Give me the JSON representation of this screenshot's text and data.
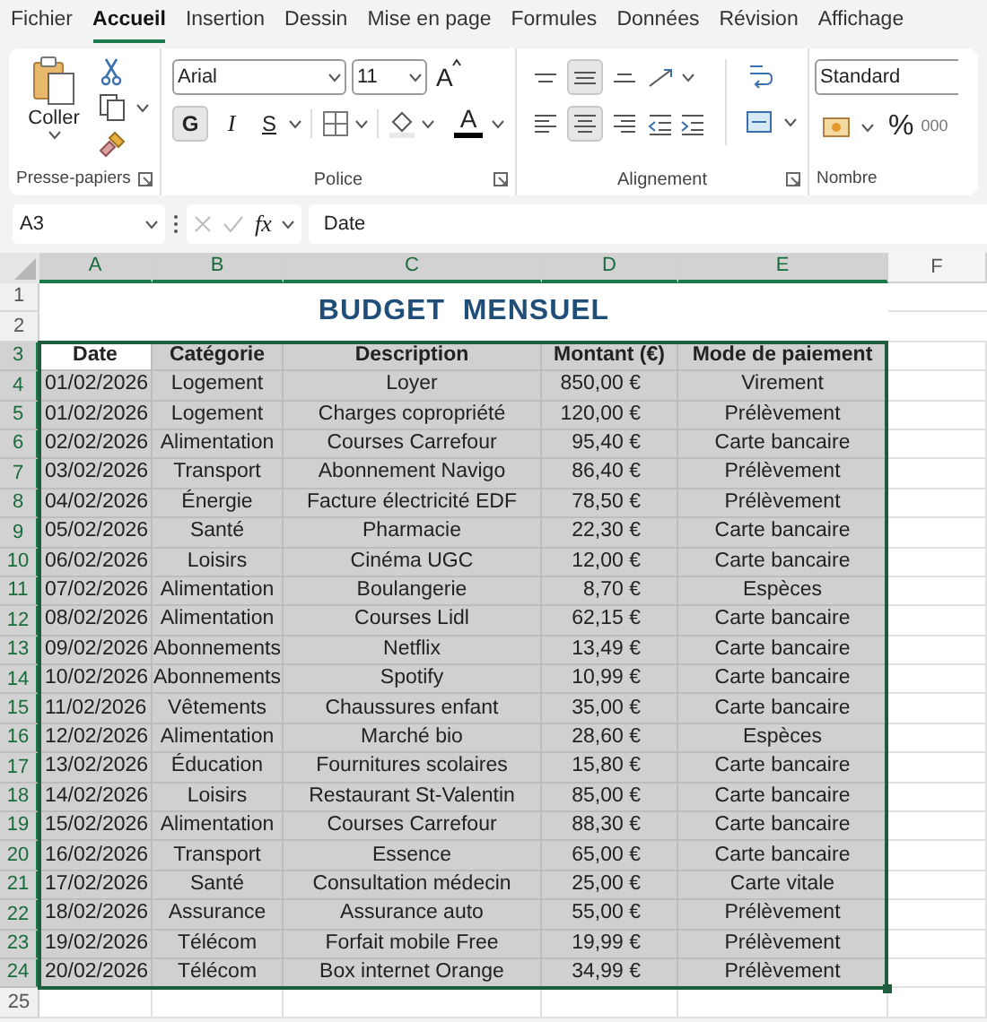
{
  "menu_tabs": [
    {
      "label": "Fichier",
      "selected": false
    },
    {
      "label": "Accueil",
      "selected": true
    },
    {
      "label": "Insertion",
      "selected": false
    },
    {
      "label": "Dessin",
      "selected": false
    },
    {
      "label": "Mise en page",
      "selected": false
    },
    {
      "label": "Formules",
      "selected": false
    },
    {
      "label": "Données",
      "selected": false
    },
    {
      "label": "Révision",
      "selected": false
    },
    {
      "label": "Affichage",
      "selected": false
    }
  ],
  "ribbon": {
    "clipboard": {
      "paste_label": "Coller",
      "group_label": "Presse-papiers"
    },
    "font": {
      "font_name": "Arial",
      "font_size": "11",
      "grow_label": "A",
      "bold": {
        "label": "G",
        "pressed": true
      },
      "italic": {
        "label": "I",
        "pressed": false
      },
      "underline": {
        "label": "S",
        "pressed": false
      },
      "color_label": "A",
      "group_label": "Police"
    },
    "alignment": {
      "vertical": [
        {
          "kind": "top",
          "pressed": false
        },
        {
          "kind": "middle",
          "pressed": true
        },
        {
          "kind": "bottom",
          "pressed": false
        }
      ],
      "horizontal": [
        {
          "kind": "left",
          "pressed": false
        },
        {
          "kind": "center",
          "pressed": true
        },
        {
          "kind": "right",
          "pressed": false
        }
      ],
      "group_label": "Alignement"
    },
    "number": {
      "format": "Standard",
      "percent_label": "%",
      "thousands_label": "000",
      "group_label": "Nombre"
    }
  },
  "formula_bar": {
    "name_box": "A3",
    "fx_label": "fx",
    "value": "Date"
  },
  "columns": [
    {
      "letter": "A",
      "selected": true
    },
    {
      "letter": "B",
      "selected": true
    },
    {
      "letter": "C",
      "selected": true
    },
    {
      "letter": "D",
      "selected": true
    },
    {
      "letter": "E",
      "selected": true
    },
    {
      "letter": "F",
      "selected": false
    }
  ],
  "title": "BUDGET  MENSUEL",
  "rows": [
    {
      "number": "1",
      "selected": false,
      "kind": "title"
    },
    {
      "number": "2",
      "selected": false,
      "kind": "title"
    },
    {
      "number": "3",
      "selected": true,
      "kind": "header",
      "active": true,
      "cells": [
        "Date",
        "Catégorie",
        "Description",
        "Montant (€)",
        "Mode de paiement"
      ]
    },
    {
      "number": "4",
      "selected": true,
      "kind": "data",
      "cells": [
        "01/02/2026",
        "Logement",
        "Loyer",
        "850,00 €",
        "Virement"
      ]
    },
    {
      "number": "5",
      "selected": true,
      "kind": "data",
      "cells": [
        "01/02/2026",
        "Logement",
        "Charges copropriété",
        "120,00 €",
        "Prélèvement"
      ]
    },
    {
      "number": "6",
      "selected": true,
      "kind": "data",
      "cells": [
        "02/02/2026",
        "Alimentation",
        "Courses Carrefour",
        "95,40 €",
        "Carte bancaire"
      ]
    },
    {
      "number": "7",
      "selected": true,
      "kind": "data",
      "cells": [
        "03/02/2026",
        "Transport",
        "Abonnement Navigo",
        "86,40 €",
        "Prélèvement"
      ]
    },
    {
      "number": "8",
      "selected": true,
      "kind": "data",
      "cells": [
        "04/02/2026",
        "Énergie",
        "Facture électricité EDF",
        "78,50 €",
        "Prélèvement"
      ]
    },
    {
      "number": "9",
      "selected": true,
      "kind": "data",
      "cells": [
        "05/02/2026",
        "Santé",
        "Pharmacie",
        "22,30 €",
        "Carte bancaire"
      ]
    },
    {
      "number": "10",
      "selected": true,
      "kind": "data",
      "cells": [
        "06/02/2026",
        "Loisirs",
        "Cinéma UGC",
        "12,00 €",
        "Carte bancaire"
      ]
    },
    {
      "number": "11",
      "selected": true,
      "kind": "data",
      "cells": [
        "07/02/2026",
        "Alimentation",
        "Boulangerie",
        "8,70 €",
        "Espèces"
      ]
    },
    {
      "number": "12",
      "selected": true,
      "kind": "data",
      "cells": [
        "08/02/2026",
        "Alimentation",
        "Courses Lidl",
        "62,15 €",
        "Carte bancaire"
      ]
    },
    {
      "number": "13",
      "selected": true,
      "kind": "data",
      "cells": [
        "09/02/2026",
        "Abonnements",
        "Netflix",
        "13,49 €",
        "Carte bancaire"
      ]
    },
    {
      "number": "14",
      "selected": true,
      "kind": "data",
      "cells": [
        "10/02/2026",
        "Abonnements",
        "Spotify",
        "10,99 €",
        "Carte bancaire"
      ]
    },
    {
      "number": "15",
      "selected": true,
      "kind": "data",
      "cells": [
        "11/02/2026",
        "Vêtements",
        "Chaussures enfant",
        "35,00 €",
        "Carte bancaire"
      ]
    },
    {
      "number": "16",
      "selected": true,
      "kind": "data",
      "cells": [
        "12/02/2026",
        "Alimentation",
        "Marché bio",
        "28,60 €",
        "Espèces"
      ]
    },
    {
      "number": "17",
      "selected": true,
      "kind": "data",
      "cells": [
        "13/02/2026",
        "Éducation",
        "Fournitures scolaires",
        "15,80 €",
        "Carte bancaire"
      ]
    },
    {
      "number": "18",
      "selected": true,
      "kind": "data",
      "cells": [
        "14/02/2026",
        "Loisirs",
        "Restaurant St-Valentin",
        "85,00 €",
        "Carte bancaire"
      ]
    },
    {
      "number": "19",
      "selected": true,
      "kind": "data",
      "cells": [
        "15/02/2026",
        "Alimentation",
        "Courses Carrefour",
        "88,30 €",
        "Carte bancaire"
      ]
    },
    {
      "number": "20",
      "selected": true,
      "kind": "data",
      "cells": [
        "16/02/2026",
        "Transport",
        "Essence",
        "65,00 €",
        "Carte bancaire"
      ]
    },
    {
      "number": "21",
      "selected": true,
      "kind": "data",
      "cells": [
        "17/02/2026",
        "Santé",
        "Consultation médecin",
        "25,00 €",
        "Carte vitale"
      ]
    },
    {
      "number": "22",
      "selected": true,
      "kind": "data",
      "cells": [
        "18/02/2026",
        "Assurance",
        "Assurance auto",
        "55,00 €",
        "Prélèvement"
      ]
    },
    {
      "number": "23",
      "selected": true,
      "kind": "data",
      "cells": [
        "19/02/2026",
        "Télécom",
        "Forfait mobile Free",
        "19,99 €",
        "Prélèvement"
      ]
    },
    {
      "number": "24",
      "selected": true,
      "kind": "data",
      "cells": [
        "20/02/2026",
        "Télécom",
        "Box internet Orange",
        "34,99 €",
        "Prélèvement"
      ]
    },
    {
      "number": "25",
      "selected": false,
      "kind": "empty"
    }
  ]
}
